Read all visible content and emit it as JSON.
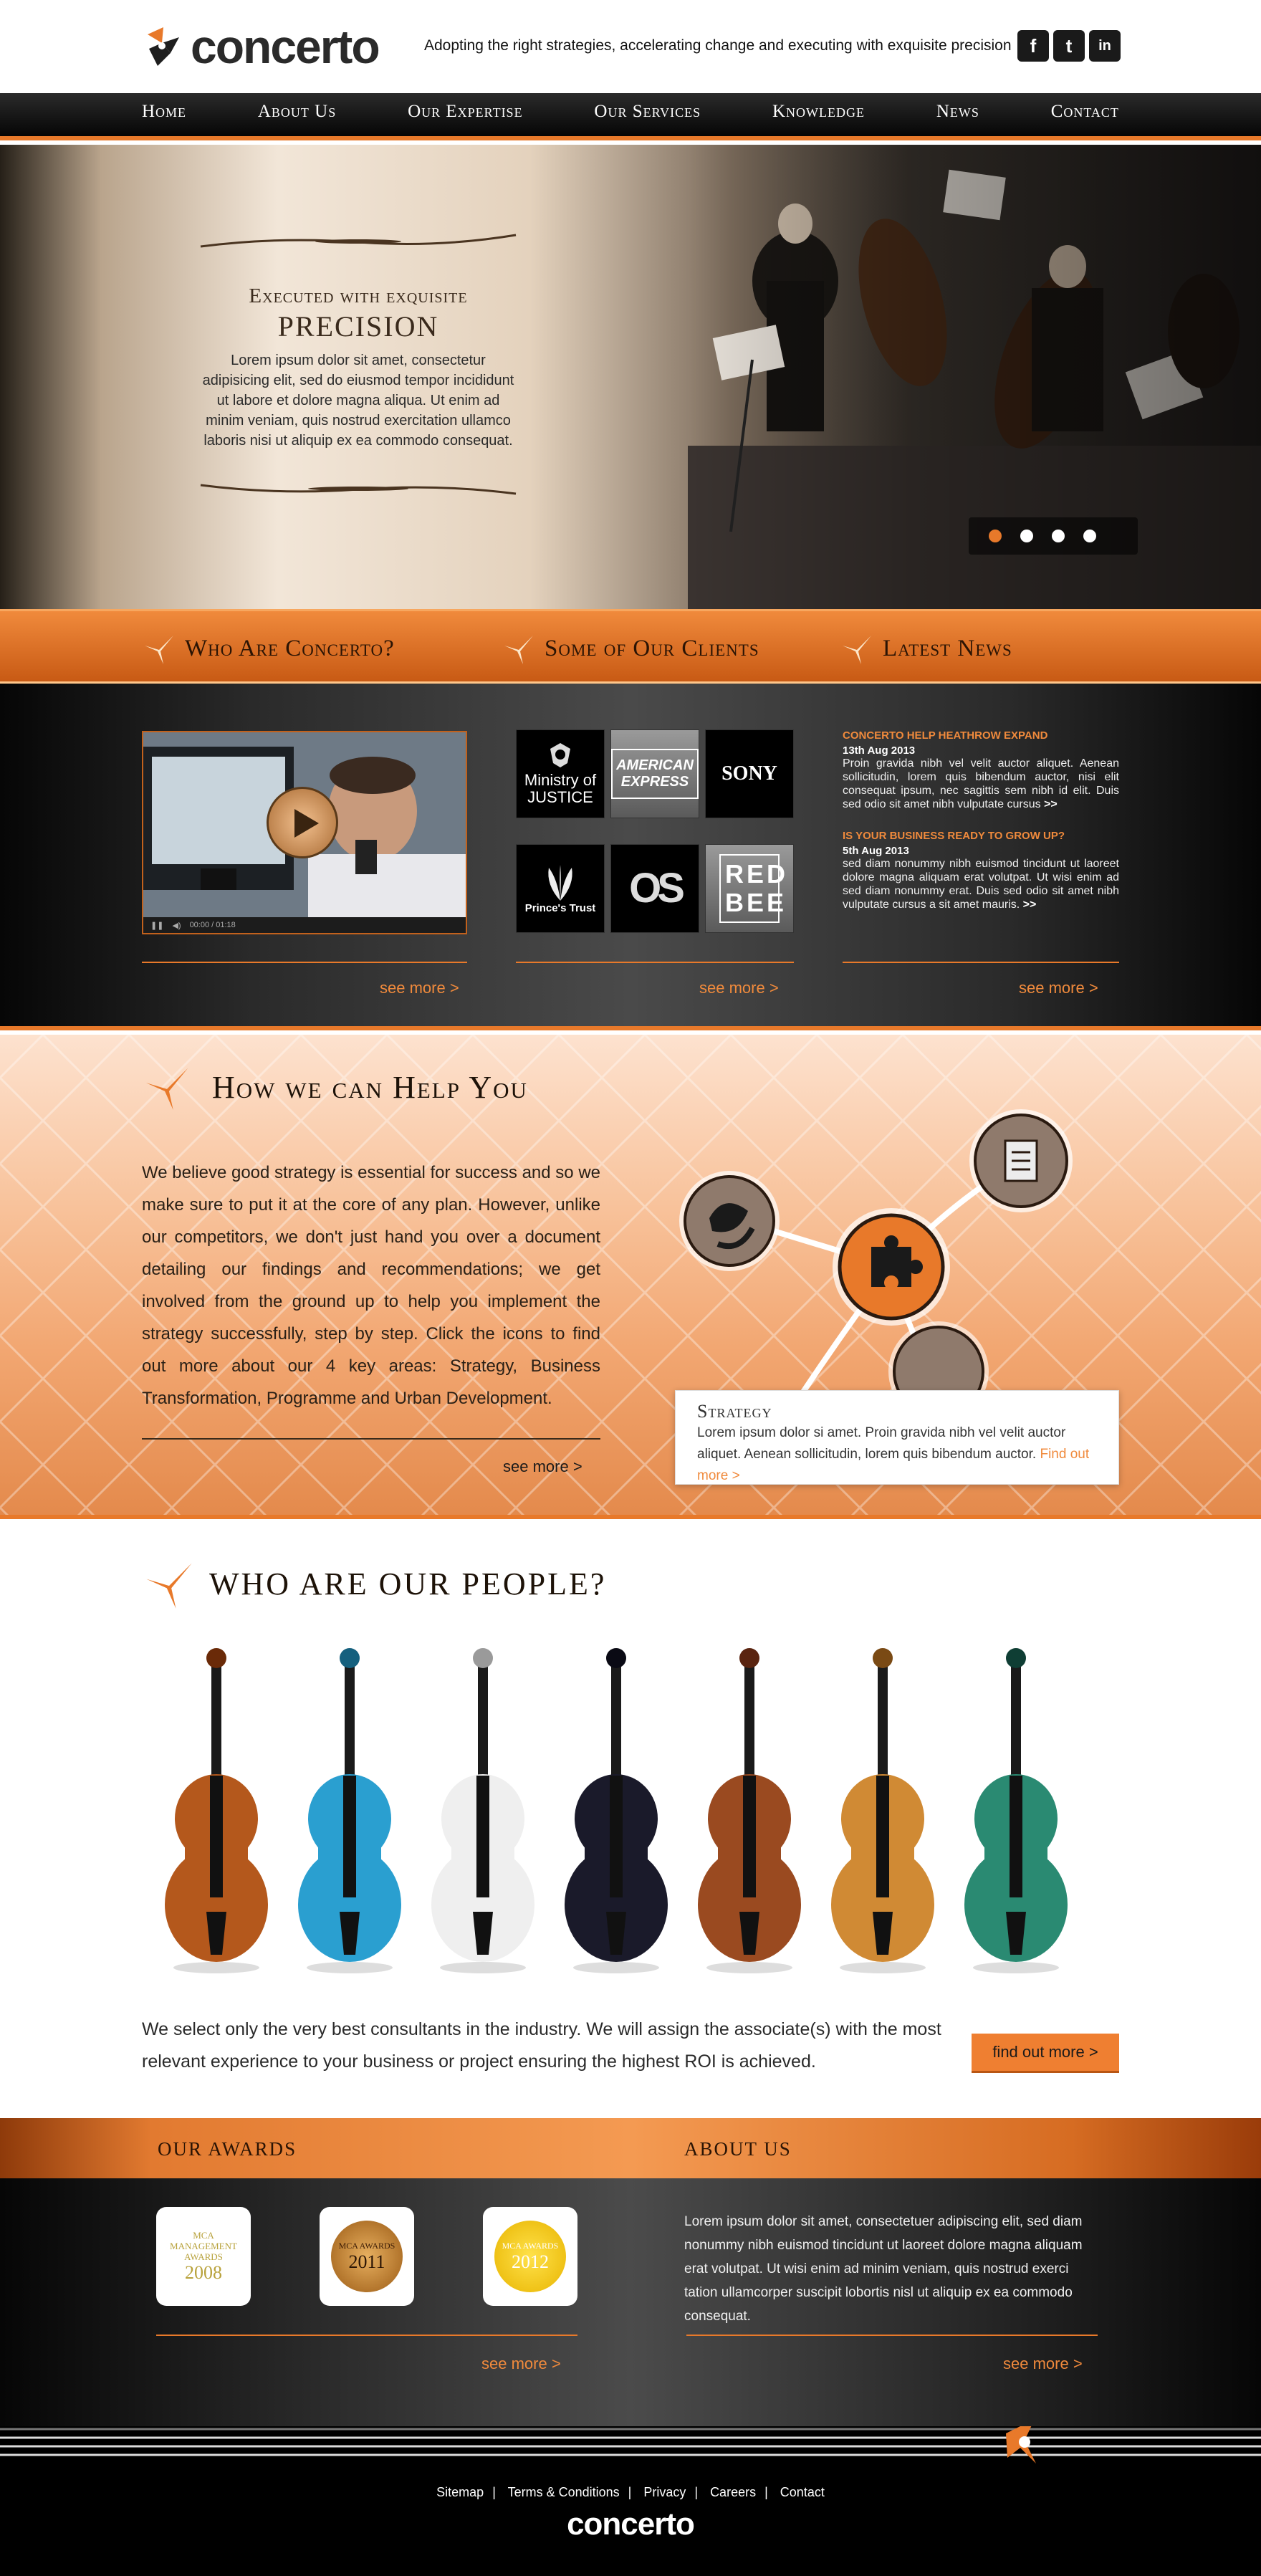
{
  "brand": {
    "name": "concerto",
    "accent": "#e8792a",
    "dark": "#111111"
  },
  "header": {
    "tagline": "Adopting the right strategies, accelerating change and executing with exquisite precision",
    "social": [
      {
        "icon": "facebook-icon",
        "glyph": "f"
      },
      {
        "icon": "twitter-icon",
        "glyph": "t"
      },
      {
        "icon": "linkedin-icon",
        "glyph": "in"
      }
    ]
  },
  "nav": [
    "Home",
    "About Us",
    "Our Expertise",
    "Our Services",
    "Knowledge",
    "News",
    "Contact"
  ],
  "hero": {
    "title_line1": "Executed with exquisite",
    "title_line2": "PRECISION",
    "body": "Lorem ipsum dolor sit amet, consectetur adipisicing elit, sed do eiusmod tempor incididunt ut labore et dolore magna aliqua. Ut enim ad minim veniam, quis nostrud exercitation ullamco laboris nisi ut aliquip ex ea commodo consequat.",
    "slides": 4,
    "active_slide": 1
  },
  "sections": {
    "who": "Who Are Concerto?",
    "clients": "Some of Our Clients",
    "news": "Latest News"
  },
  "clients": [
    {
      "name": "Ministry of JUSTICE",
      "icon": "crest-icon"
    },
    {
      "name": "AMERICAN EXPRESS",
      "icon": ""
    },
    {
      "name": "SONY",
      "icon": ""
    },
    {
      "name": "Prince's Trust",
      "icon": "feathers-icon"
    },
    {
      "name": "OS",
      "icon": ""
    },
    {
      "name": "RED BEE",
      "icon": ""
    }
  ],
  "video": {
    "time": "00:00 / 01:18"
  },
  "news": [
    {
      "headline": "Concerto help Heathrow expand",
      "date": "13th Aug 2013",
      "body": "Proin gravida nibh vel velit auctor aliquet. Aenean sollicitudin, lorem quis bibendum auctor, nisi elit consequat ipsum, nec sagittis sem nibh id elit. Duis sed odio sit amet nibh vulputate cursus",
      "more": ">>"
    },
    {
      "headline": "Is your business ready to grow up?",
      "date": "5th Aug 2013",
      "body": "sed diam nonummy nibh euismod tincidunt ut laoreet dolore magna aliquam erat volutpat. Ut wisi enim ad sed diam nonummy erat. Duis sed odio sit amet nibh vulputate cursus a sit amet mauris.",
      "more": ">>"
    }
  ],
  "see_more": "see more  >",
  "help": {
    "title": "How we can Help You",
    "body": "We believe good strategy is essential for success and so we make sure to put it at the core of any plan. However, unlike our competitors, we don't just hand you over a document detailing our findings and recommendations; we get involved from the ground up to help you implement the strategy successfully, step by step. Click the icons to find out more about our 4 key areas: Strategy, Business Transformation, Programme and Urban Development.",
    "see_more": "see more  >",
    "card": {
      "title": "Strategy",
      "body": "Lorem ipsum dolor si amet. Proin gravida nibh vel velit auctor aliquet. Aenean sollicitudin, lorem quis bibendum auctor.",
      "link": "Find out more >"
    },
    "nodes": [
      "document-icon",
      "programme-icon",
      "puzzle-icon",
      "tools-icon"
    ]
  },
  "people": {
    "title": "WHO ARE OUR PEOPLE?",
    "body": "We select only the very best consultants in the industry. We will assign the associate(s) with the most relevant experience to your business or project ensuring the highest ROI is achieved.",
    "button": "find out more  >"
  },
  "awards": {
    "title": "OUR AWARDS",
    "items": [
      {
        "label": "MCA MANAGEMENT AWARDS",
        "year": "2008"
      },
      {
        "label": "MCA AWARDS",
        "year": "2011"
      },
      {
        "label": "MCA AWARDS",
        "year": "2012"
      }
    ],
    "see_more": "see more  >"
  },
  "about": {
    "title": "ABOUT US",
    "body": "Lorem ipsum dolor sit amet, consectetuer adipiscing elit, sed diam nonummy nibh euismod tincidunt ut laoreet dolore magna aliquam erat volutpat. Ut wisi enim ad minim veniam, quis nostrud exerci tation ullamcorper suscipit lobortis nisl ut aliquip ex ea commodo consequat.",
    "see_more": "see more  >"
  },
  "footer": {
    "links": [
      "Sitemap",
      "Terms & Conditions",
      "Privacy",
      "Careers",
      "Contact"
    ],
    "logo": "concerto"
  }
}
